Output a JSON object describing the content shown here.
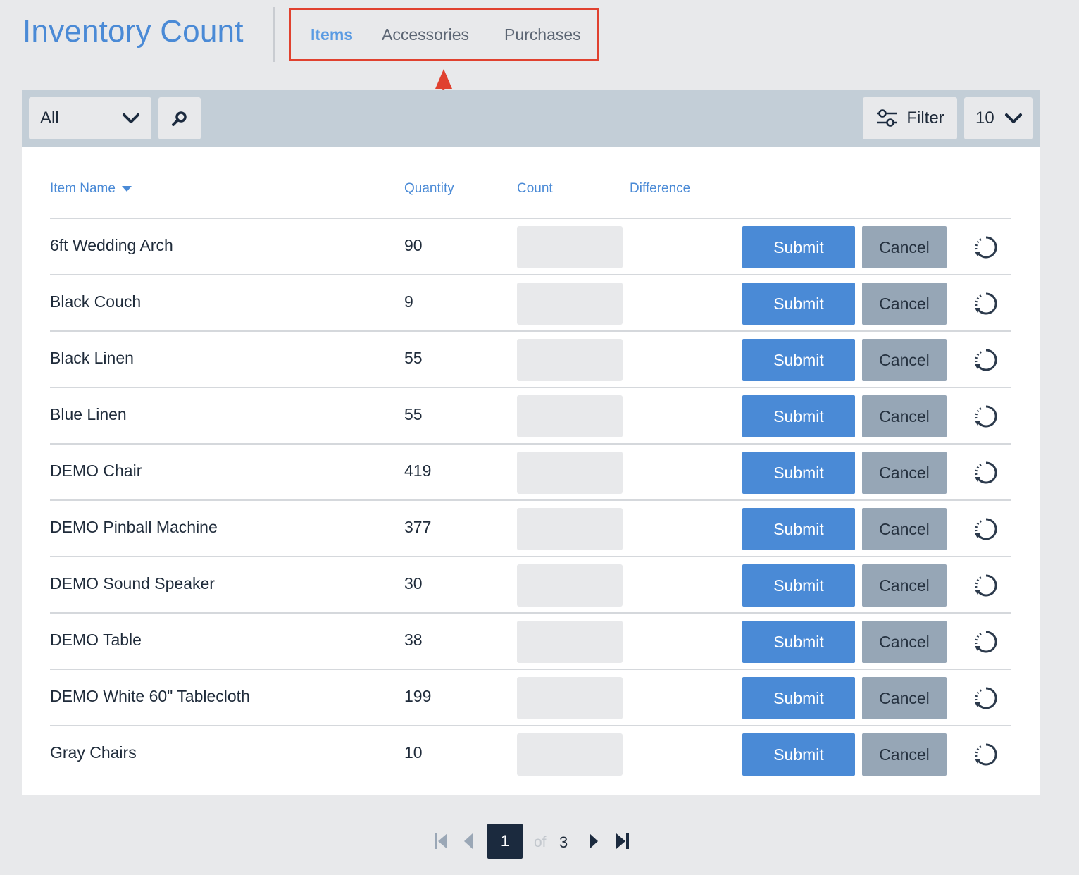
{
  "header": {
    "title": "Inventory Count",
    "tabs": [
      {
        "label": "Items",
        "active": true
      },
      {
        "label": "Accessories",
        "active": false
      },
      {
        "label": "Purchases",
        "active": false
      }
    ]
  },
  "toolbar": {
    "category_select": "All",
    "filter_label": "Filter",
    "per_page": "10"
  },
  "table": {
    "columns": {
      "name": "Item Name",
      "quantity": "Quantity",
      "count": "Count",
      "difference": "Difference"
    },
    "submit_label": "Submit",
    "cancel_label": "Cancel",
    "rows": [
      {
        "name": "6ft Wedding Arch",
        "quantity": "90"
      },
      {
        "name": "Black Couch",
        "quantity": "9"
      },
      {
        "name": "Black Linen",
        "quantity": "55"
      },
      {
        "name": "Blue Linen",
        "quantity": "55"
      },
      {
        "name": "DEMO Chair",
        "quantity": "419"
      },
      {
        "name": "DEMO Pinball Machine",
        "quantity": "377"
      },
      {
        "name": "DEMO Sound Speaker",
        "quantity": "30"
      },
      {
        "name": "DEMO Table",
        "quantity": "38"
      },
      {
        "name": "DEMO White 60\" Tablecloth",
        "quantity": "199"
      },
      {
        "name": "Gray Chairs",
        "quantity": "10"
      }
    ]
  },
  "pagination": {
    "current": "1",
    "of_label": "of",
    "total": "3"
  },
  "colors": {
    "accent": "#4a8ad6",
    "annotation": "#e0412f",
    "cancel": "#96a6b6",
    "toolbar": "#c3ced7"
  }
}
